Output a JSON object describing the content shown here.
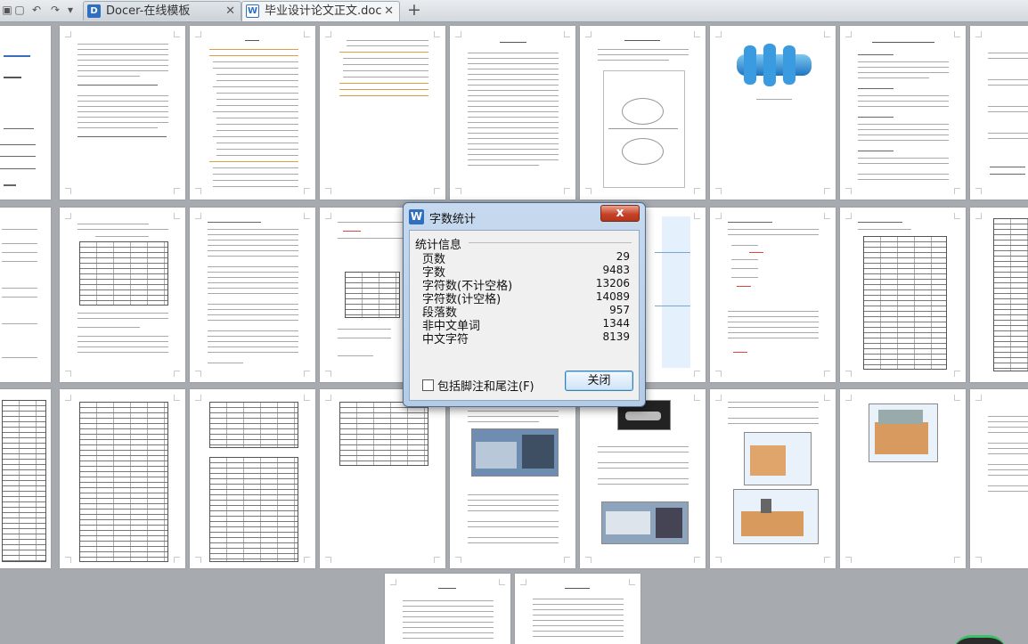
{
  "tabs": [
    {
      "title": "Docer-在线模板",
      "icon": "D",
      "active": false
    },
    {
      "title": "毕业设计论文正文.doc",
      "icon": "W",
      "active": true
    }
  ],
  "dialog": {
    "title": "字数统计",
    "group_title": "统计信息",
    "stats": [
      {
        "label": "页数",
        "value": "29"
      },
      {
        "label": "字数",
        "value": "9483"
      },
      {
        "label": "字符数(不计空格)",
        "value": "13206"
      },
      {
        "label": "字符数(计空格)",
        "value": "14089"
      },
      {
        "label": "段落数",
        "value": "957"
      },
      {
        "label": "非中文单词",
        "value": "1344"
      },
      {
        "label": "中文字符",
        "value": "8139"
      }
    ],
    "checkbox_label": "包括脚注和尾注(F)",
    "checkbox_checked": false,
    "close_label": "关闭",
    "close_x": "x"
  },
  "colors": {
    "canvas_bg": "#a7abaf",
    "dialog_frame": "#b4cbe6",
    "close_red": "#c6432a",
    "doc_icon": "#2f6fbf"
  }
}
